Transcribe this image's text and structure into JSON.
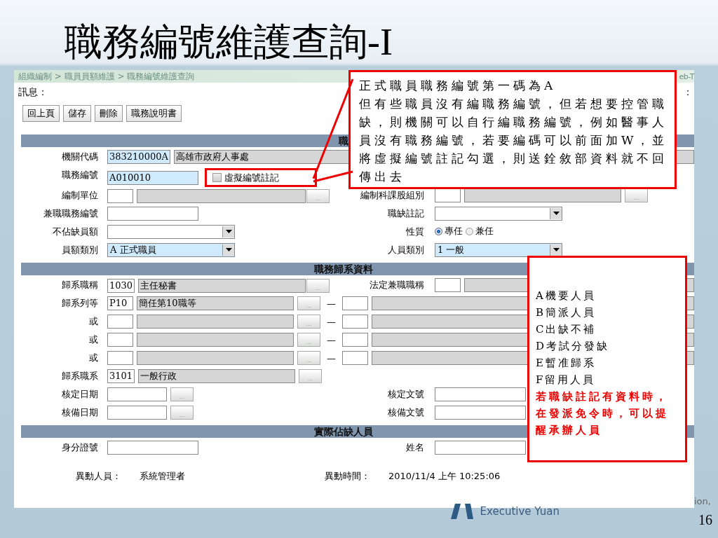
{
  "slide": {
    "title": "職務編號維護查詢-I",
    "logo_text": "Executive Yuan",
    "edge_text": "ion,",
    "page_number": "16"
  },
  "screen": {
    "breadcrumb": "組織編制 > 職員員額維護 > 職務編號維護查詢",
    "breadcrumb_edge": "eb-T",
    "message_label": "訊息：",
    "message_edge": "：",
    "buttons": [
      "回上頁",
      "儲存",
      "刪除",
      "職務說明書"
    ],
    "sections": [
      {
        "title": "職",
        "rows": [
          {
            "left": {
              "label": "機關代碼",
              "fields": [
                {
                  "kind": "code",
                  "value": "383210000A",
                  "shaded": true
                },
                {
                  "kind": "name",
                  "value": "高雄市政府人事處"
                }
              ]
            }
          },
          {
            "left": {
              "label": "職務編號",
              "fields": [
                {
                  "kind": "text",
                  "value": "A010010",
                  "shaded": true
                },
                {
                  "kind": "checkbox",
                  "label": "虛擬編號註記",
                  "checked": false,
                  "highlighted": true
                }
              ]
            }
          },
          {
            "left": {
              "label": "編制單位",
              "fields": [
                {
                  "kind": "code",
                  "shaded": false
                },
                {
                  "kind": "name"
                },
                {
                  "kind": "lookup",
                  "label": "...",
                  "below": true
                }
              ]
            },
            "right": {
              "label": "編制科課股組別",
              "fields": [
                {
                  "kind": "code",
                  "shaded": false
                },
                {
                  "kind": "name"
                },
                {
                  "kind": "lookup",
                  "label": "..."
                }
              ]
            }
          },
          {
            "left": {
              "label": "兼職職務編號",
              "fields": [
                {
                  "kind": "text",
                  "shaded": false
                }
              ]
            },
            "right": {
              "label": "職缺註記",
              "fields": [
                {
                  "kind": "select",
                  "shaded": false
                }
              ]
            }
          },
          {
            "left": {
              "label": "不佔缺員額",
              "fields": [
                {
                  "kind": "select",
                  "shaded": false
                }
              ]
            },
            "right": {
              "label": "性質",
              "fields": [
                {
                  "kind": "radio",
                  "options": [
                    {
                      "label": "專任",
                      "selected": true
                    },
                    {
                      "label": "兼任",
                      "selected": false
                    }
                  ]
                }
              ]
            }
          },
          {
            "left": {
              "label": "員額類別",
              "fields": [
                {
                  "kind": "select",
                  "value": "A 正式職員",
                  "shaded": true
                }
              ]
            },
            "right": {
              "label": "人員類別",
              "fields": [
                {
                  "kind": "select",
                  "value": "1 一般",
                  "shaded": true
                }
              ]
            }
          }
        ]
      },
      {
        "title": "職務歸系資料",
        "rows": [
          {
            "left": {
              "label": "歸系職稱",
              "fields": [
                {
                  "kind": "code",
                  "value": "1030",
                  "shaded": false
                },
                {
                  "kind": "name",
                  "value": "主任秘書"
                },
                {
                  "kind": "lookup",
                  "label": "...",
                  "below": true
                }
              ]
            },
            "right": {
              "label": "法定兼職職稱",
              "fields": [
                {
                  "kind": "code",
                  "shaded": false
                },
                {
                  "kind": "name"
                }
              ]
            }
          },
          {
            "left": {
              "label": "歸系列等",
              "fields": [
                {
                  "kind": "code",
                  "value": "P10",
                  "shaded": false
                },
                {
                  "kind": "name",
                  "value": "簡任第10職等"
                },
                {
                  "kind": "lookup",
                  "label": "..."
                },
                {
                  "kind": "dash",
                  "text": "—"
                },
                {
                  "kind": "code",
                  "shaded": false
                },
                {
                  "kind": "name"
                }
              ]
            }
          },
          {
            "left": {
              "label": "或",
              "fields": [
                {
                  "kind": "code",
                  "shaded": false
                },
                {
                  "kind": "name"
                },
                {
                  "kind": "lookup",
                  "label": "..."
                },
                {
                  "kind": "dash",
                  "text": "—"
                },
                {
                  "kind": "code",
                  "shaded": false
                },
                {
                  "kind": "name"
                }
              ]
            }
          },
          {
            "left": {
              "label": "或",
              "fields": [
                {
                  "kind": "code",
                  "shaded": false
                },
                {
                  "kind": "name"
                },
                {
                  "kind": "lookup",
                  "label": "..."
                },
                {
                  "kind": "dash",
                  "text": "—"
                },
                {
                  "kind": "code",
                  "shaded": false
                },
                {
                  "kind": "name"
                }
              ]
            }
          },
          {
            "left": {
              "label": "或",
              "fields": [
                {
                  "kind": "code",
                  "shaded": false
                },
                {
                  "kind": "name"
                },
                {
                  "kind": "lookup",
                  "label": "..."
                },
                {
                  "kind": "dash",
                  "text": "—"
                },
                {
                  "kind": "code",
                  "shaded": false
                },
                {
                  "kind": "name"
                }
              ]
            }
          },
          {
            "left": {
              "label": "歸系職系",
              "fields": [
                {
                  "kind": "code",
                  "value": "3101",
                  "shaded": false
                },
                {
                  "kind": "name",
                  "value": "一般行政"
                },
                {
                  "kind": "lookup",
                  "label": "..."
                }
              ]
            }
          },
          {
            "left": {
              "label": "核定日期",
              "fields": [
                {
                  "kind": "date",
                  "shaded": false
                },
                {
                  "kind": "lookup",
                  "label": "..."
                }
              ]
            },
            "right": {
              "label": "核定文號",
              "fields": [
                {
                  "kind": "text",
                  "shaded": false
                }
              ]
            }
          },
          {
            "left": {
              "label": "核備日期",
              "fields": [
                {
                  "kind": "date",
                  "shaded": false
                },
                {
                  "kind": "lookup",
                  "label": "..."
                }
              ]
            },
            "right": {
              "label": "核備文號",
              "fields": [
                {
                  "kind": "text",
                  "shaded": false
                }
              ]
            }
          }
        ]
      },
      {
        "title": "實際佔缺人員",
        "rows": [
          {
            "left": {
              "label": "身分證號",
              "fields": [
                {
                  "kind": "text",
                  "shaded": false
                }
              ]
            },
            "right": {
              "label": "姓名",
              "fields": [
                {
                  "kind": "text",
                  "shaded": false
                }
              ]
            }
          }
        ]
      }
    ],
    "footer": [
      {
        "label": "異動人員：",
        "value": "系統管理者"
      },
      {
        "label": "異動時間：",
        "value": "2010/11/4 上午 10:25:06"
      }
    ]
  },
  "note_callout": {
    "text": "正式職員職務編號第一碼為A\n但有些職員沒有編職務編號，但若想要控管職缺，則機關可以自行編職務編號，例如醫事人員沒有職務編號，若要編碼可以前面加W，並將虛擬編號註記勾選，則送銓敘部資料就不回傳出去"
  },
  "legend_callout": {
    "items": [
      "A機要人員",
      "B簡派人員",
      "C出缺不補",
      "D考試分發缺",
      "E暫准歸系",
      "F留用人員"
    ],
    "note": "若職缺註記有資料時，在發派免令時，可以提醒承辦人員"
  }
}
